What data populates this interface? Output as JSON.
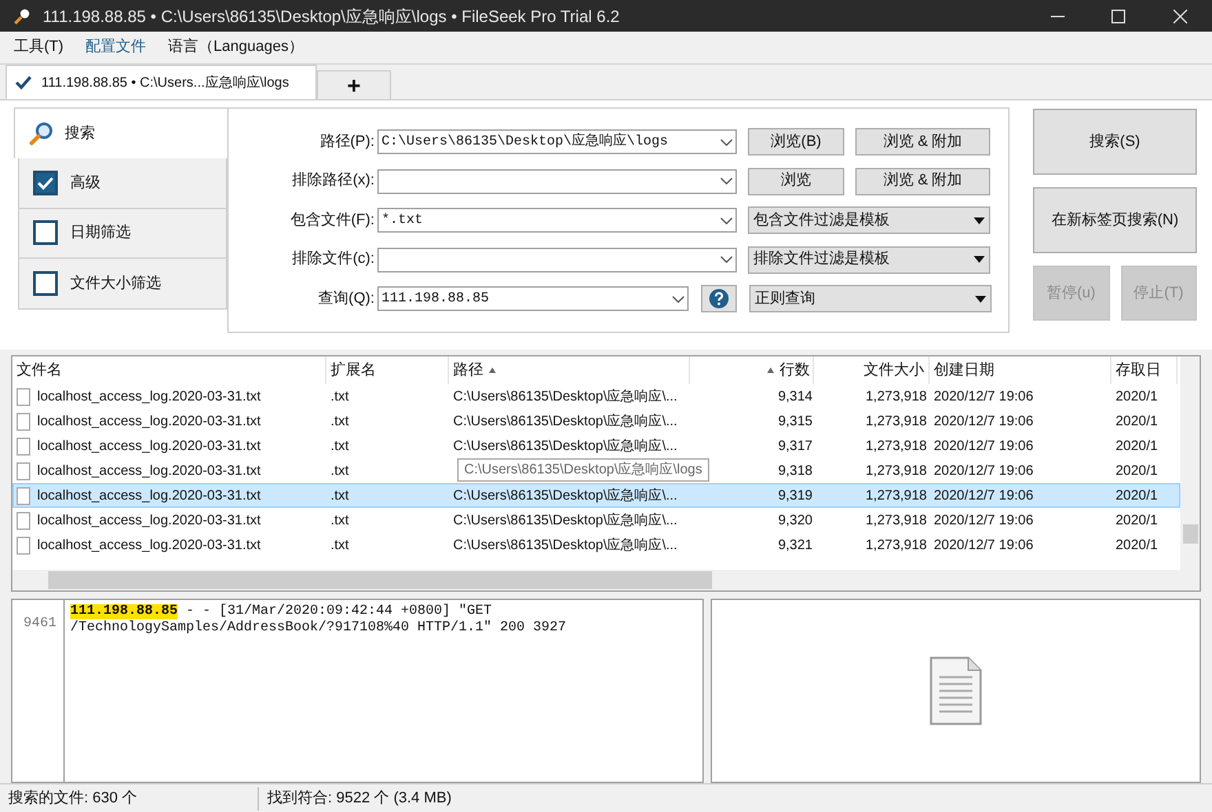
{
  "window": {
    "title": "111.198.88.85 • C:\\Users\\86135\\Desktop\\应急响应\\logs • FileSeek Pro Trial 6.2"
  },
  "menu": [
    {
      "label": "工具(T)",
      "selected": false
    },
    {
      "label": "配置文件",
      "selected": true
    },
    {
      "label": "语言（Languages）",
      "selected": false
    }
  ],
  "tabs": [
    {
      "label": "111.198.88.85 • C:\\Users...应急响应\\logs",
      "selected": true,
      "kind": "search"
    },
    {
      "label": "+",
      "selected": false,
      "kind": "add"
    }
  ],
  "sidebar": {
    "items": [
      {
        "label": "搜索",
        "kind": "tab",
        "selected": true
      },
      {
        "label": "高级",
        "kind": "checkbox",
        "checked": true
      },
      {
        "label": "日期筛选",
        "kind": "checkbox",
        "checked": false
      },
      {
        "label": "文件大小筛选",
        "kind": "checkbox",
        "checked": false
      }
    ]
  },
  "form": {
    "rows": [
      {
        "label": "路径(P):",
        "value": "C:\\Users\\86135\\Desktop\\应急响应\\logs",
        "kind": "buttons",
        "buttons": [
          "浏览(B)",
          "浏览 & 附加"
        ]
      },
      {
        "label": "排除路径(x):",
        "value": "",
        "kind": "buttons",
        "buttons": [
          "浏览",
          "浏览 & 附加"
        ]
      },
      {
        "label": "包含文件(F):",
        "value": "*.txt",
        "kind": "dropdown",
        "option": "包含文件过滤是模板"
      },
      {
        "label": "排除文件(c):",
        "value": "",
        "kind": "dropdown",
        "option": "排除文件过滤是模板"
      },
      {
        "label": "查询(Q):",
        "value": "111.198.88.85",
        "kind": "help",
        "option": "正则查询"
      }
    ]
  },
  "actions": [
    {
      "label": "搜索(S)",
      "disabled": false
    },
    {
      "label": "在新标签页搜索(N)",
      "disabled": false
    },
    {
      "label": "暂停(u)",
      "disabled": true
    },
    {
      "label": "停止(T)",
      "disabled": true
    }
  ],
  "table": {
    "columns": [
      {
        "label": "文件名",
        "sorted": false
      },
      {
        "label": "扩展名",
        "sorted": false
      },
      {
        "label": "路径",
        "sorted": true
      },
      {
        "label": "行数",
        "sorted": true
      },
      {
        "label": "文件大小",
        "sorted": false
      },
      {
        "label": "创建日期",
        "sorted": false
      },
      {
        "label": "存取日",
        "sorted": false
      }
    ],
    "rows": [
      {
        "name": "localhost_access_log.2020-03-31.txt",
        "ext": ".txt",
        "path": "C:\\Users\\86135\\Desktop\\应急响应\\...",
        "lines": "9,314",
        "size": "1,273,918",
        "created": "2020/12/7 19:06",
        "accessed": "2020/1",
        "selected": false
      },
      {
        "name": "localhost_access_log.2020-03-31.txt",
        "ext": ".txt",
        "path": "C:\\Users\\86135\\Desktop\\应急响应\\...",
        "lines": "9,315",
        "size": "1,273,918",
        "created": "2020/12/7 19:06",
        "accessed": "2020/1",
        "selected": false
      },
      {
        "name": "localhost_access_log.2020-03-31.txt",
        "ext": ".txt",
        "path": "C:\\Users\\86135\\Desktop\\应急响应\\...",
        "lines": "9,317",
        "size": "1,273,918",
        "created": "2020/12/7 19:06",
        "accessed": "2020/1",
        "selected": false
      },
      {
        "name": "localhost_access_log.2020-03-31.txt",
        "ext": ".txt",
        "tooltip": "C:\\Users\\86135\\Desktop\\应急响应\\logs",
        "lines": "9,318",
        "size": "1,273,918",
        "created": "2020/12/7 19:06",
        "accessed": "2020/1",
        "selected": false
      },
      {
        "name": "localhost_access_log.2020-03-31.txt",
        "ext": ".txt",
        "path": "C:\\Users\\86135\\Desktop\\应急响应\\...",
        "lines": "9,319",
        "size": "1,273,918",
        "created": "2020/12/7 19:06",
        "accessed": "2020/1",
        "selected": true
      },
      {
        "name": "localhost_access_log.2020-03-31.txt",
        "ext": ".txt",
        "path": "C:\\Users\\86135\\Desktop\\应急响应\\...",
        "lines": "9,320",
        "size": "1,273,918",
        "created": "2020/12/7 19:06",
        "accessed": "2020/1",
        "selected": false
      },
      {
        "name": "localhost_access_log.2020-03-31.txt",
        "ext": ".txt",
        "path": "C:\\Users\\86135\\Desktop\\应急响应\\...",
        "lines": "9,321",
        "size": "1,273,918",
        "created": "2020/12/7 19:06",
        "accessed": "2020/1",
        "selected": false
      }
    ]
  },
  "preview": {
    "line_number": "9461",
    "lines": [
      [
        {
          "text": "111.198.88.85",
          "highlighted": true
        },
        {
          "text": " - - [31/Mar/2020:09:42:44 +0800] \"GET",
          "highlighted": false
        }
      ],
      [
        {
          "text": "/TechnologySamples/AddressBook/?917108%40 HTTP/1.1\" 200 3927",
          "highlighted": false
        }
      ]
    ]
  },
  "status_bar": [
    "搜索的文件: 630 个",
    "找到符合: 9522 个 (3.4 MB)"
  ]
}
